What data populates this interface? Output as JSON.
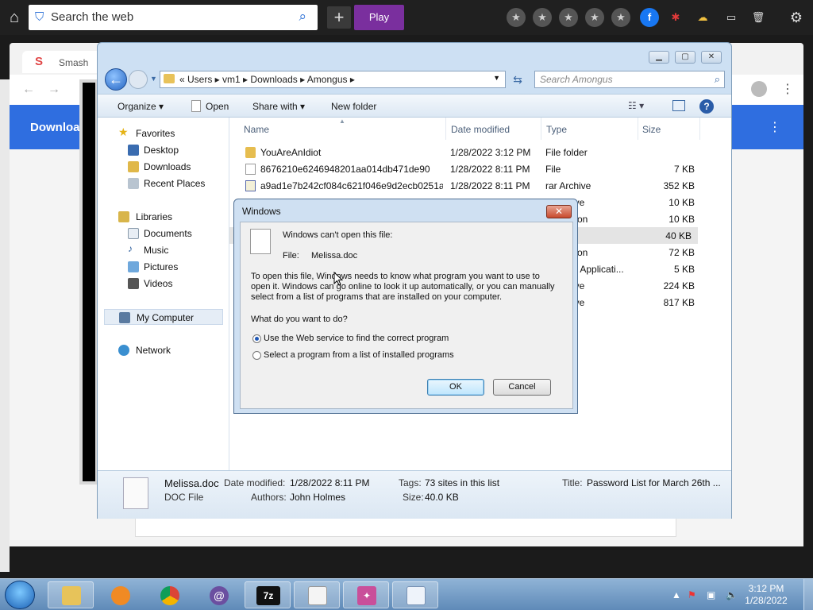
{
  "topbar": {
    "search_text": "Search the web",
    "play_label": "Play"
  },
  "bg_browser": {
    "tab_title": "Smash",
    "banner_text": "Downloa"
  },
  "explorer": {
    "crumbs": "«  Users  ▸  vm1  ▸  Downloads  ▸  Amongus  ▸",
    "search_placeholder": "Search Amongus",
    "toolbar": {
      "organize": "Organize ▾",
      "open": "Open",
      "share_with": "Share with ▾",
      "new_folder": "New folder"
    },
    "nav": {
      "favorites": "Favorites",
      "desktop": "Desktop",
      "downloads": "Downloads",
      "recent": "Recent Places",
      "libraries": "Libraries",
      "documents": "Documents",
      "music": "Music",
      "pictures": "Pictures",
      "videos": "Videos",
      "my_computer": "My Computer",
      "network": "Network"
    },
    "columns": {
      "name": "Name",
      "date": "Date modified",
      "type": "Type",
      "size": "Size"
    },
    "rows": [
      {
        "name": "YouAreAnIdiot",
        "date": "1/28/2022 3:12 PM",
        "type": "File folder",
        "size": ""
      },
      {
        "name": "8676210e6246948201aa014db471de90",
        "date": "1/28/2022 8:11 PM",
        "type": "File",
        "size": "7 KB"
      },
      {
        "name": "a9ad1e7b242cf084c621f046e9d2ecb0251a...",
        "date": "1/28/2022 8:11 PM",
        "type": "rar Archive",
        "size": "352 KB"
      },
      {
        "name": "",
        "date": "",
        "type": "ive",
        "size": "10 KB"
      },
      {
        "name": "",
        "date": "",
        "type": "tion",
        "size": "10 KB"
      },
      {
        "name": "",
        "date": "",
        "type": "e",
        "size": "40 KB"
      },
      {
        "name": "",
        "date": "",
        "type": "tion",
        "size": "72 KB"
      },
      {
        "name": "",
        "date": "",
        "type": "6 Applicati...",
        "size": "5 KB"
      },
      {
        "name": "",
        "date": "",
        "type": "ive",
        "size": "224 KB"
      },
      {
        "name": "",
        "date": "",
        "type": "ive",
        "size": "817 KB"
      }
    ],
    "details": {
      "filename": "Melissa.doc",
      "filetype": "DOC File",
      "date_label": "Date modified:",
      "date_value": "1/28/2022 8:11 PM",
      "authors_label": "Authors:",
      "authors_value": "John Holmes",
      "tags_label": "Tags:",
      "tags_value": "73 sites in this list",
      "size_label": "Size:",
      "size_value": "40.0 KB",
      "title_label": "Title:",
      "title_value": "Password List for March 26th ..."
    }
  },
  "dialog": {
    "title": "Windows",
    "heading": "Windows can't open this file:",
    "file_label": "File:",
    "file_name": "Melissa.doc",
    "para1": "To open this file, Windows needs to know what program you want to use to",
    "para2": "open it. Windows can go online to look it up automatically, or you can manually",
    "para3": "select from a list of programs that are installed on your computer.",
    "question": "What do you want to do?",
    "option1": "Use the Web service to find the correct program",
    "option2": "Select a program from a list of installed programs",
    "option1_selected": true,
    "ok": "OK",
    "cancel": "Cancel"
  },
  "taskbar": {
    "time": "3:12 PM",
    "date": "1/28/2022",
    "apps": [
      "explorer-icon",
      "media-player-icon",
      "chrome-icon",
      "at-icon",
      "7zip-icon",
      "notepad-icon",
      "star-app-icon",
      "file-icon"
    ]
  }
}
